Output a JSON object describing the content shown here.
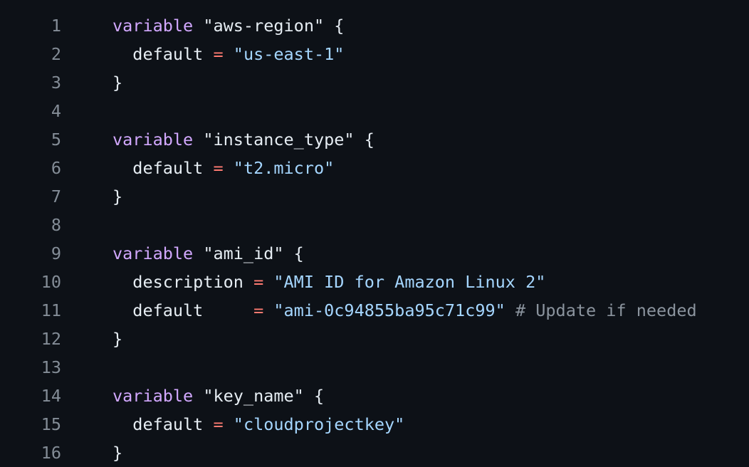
{
  "lines": [
    {
      "num": "1",
      "tokens": [
        {
          "t": "kw",
          "v": "variable"
        },
        {
          "t": "plain",
          "v": " "
        },
        {
          "t": "plain",
          "v": "\"aws-region\" {"
        }
      ]
    },
    {
      "num": "2",
      "tokens": [
        {
          "t": "plain",
          "v": "  default "
        },
        {
          "t": "op",
          "v": "="
        },
        {
          "t": "plain",
          "v": " "
        },
        {
          "t": "str",
          "v": "\"us-east-1\""
        }
      ]
    },
    {
      "num": "3",
      "tokens": [
        {
          "t": "plain",
          "v": "}"
        }
      ]
    },
    {
      "num": "4",
      "tokens": []
    },
    {
      "num": "5",
      "tokens": [
        {
          "t": "kw",
          "v": "variable"
        },
        {
          "t": "plain",
          "v": " "
        },
        {
          "t": "plain",
          "v": "\"instance_type\" {"
        }
      ]
    },
    {
      "num": "6",
      "tokens": [
        {
          "t": "plain",
          "v": "  default "
        },
        {
          "t": "op",
          "v": "="
        },
        {
          "t": "plain",
          "v": " "
        },
        {
          "t": "str",
          "v": "\"t2.micro\""
        }
      ]
    },
    {
      "num": "7",
      "tokens": [
        {
          "t": "plain",
          "v": "}"
        }
      ]
    },
    {
      "num": "8",
      "tokens": []
    },
    {
      "num": "9",
      "tokens": [
        {
          "t": "kw",
          "v": "variable"
        },
        {
          "t": "plain",
          "v": " "
        },
        {
          "t": "plain",
          "v": "\"ami_id\" {"
        }
      ]
    },
    {
      "num": "10",
      "tokens": [
        {
          "t": "plain",
          "v": "  description "
        },
        {
          "t": "op",
          "v": "="
        },
        {
          "t": "plain",
          "v": " "
        },
        {
          "t": "str",
          "v": "\"AMI ID for Amazon Linux 2\""
        }
      ]
    },
    {
      "num": "11",
      "tokens": [
        {
          "t": "plain",
          "v": "  default     "
        },
        {
          "t": "op",
          "v": "="
        },
        {
          "t": "plain",
          "v": " "
        },
        {
          "t": "str",
          "v": "\"ami-0c94855ba95c71c99\""
        },
        {
          "t": "plain",
          "v": " "
        },
        {
          "t": "cm",
          "v": "# Update if needed"
        }
      ]
    },
    {
      "num": "12",
      "tokens": [
        {
          "t": "plain",
          "v": "}"
        }
      ]
    },
    {
      "num": "13",
      "tokens": []
    },
    {
      "num": "14",
      "tokens": [
        {
          "t": "kw",
          "v": "variable"
        },
        {
          "t": "plain",
          "v": " "
        },
        {
          "t": "plain",
          "v": "\"key_name\" {"
        }
      ]
    },
    {
      "num": "15",
      "tokens": [
        {
          "t": "plain",
          "v": "  default "
        },
        {
          "t": "op",
          "v": "="
        },
        {
          "t": "plain",
          "v": " "
        },
        {
          "t": "str",
          "v": "\"cloudprojectkey\""
        }
      ]
    },
    {
      "num": "16",
      "tokens": [
        {
          "t": "plain",
          "v": "}"
        }
      ]
    }
  ],
  "colors": {
    "background": "#0d1117",
    "keyword": "#d2a8ff",
    "string": "#a5d6ff",
    "operator": "#ff7b72",
    "comment": "#8b949e",
    "line_number": "#848d97"
  }
}
